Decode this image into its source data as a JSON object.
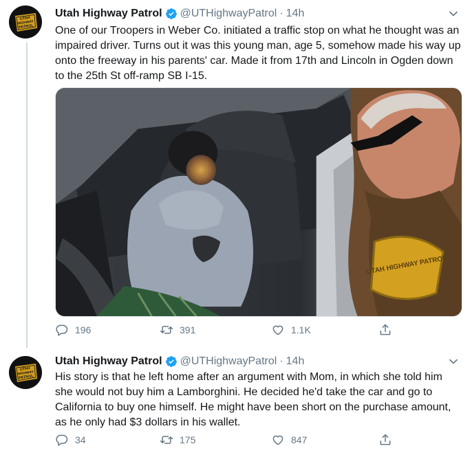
{
  "colors": {
    "text_primary": "#14171a",
    "text_secondary": "#657786",
    "verified_blue": "#1da1f2",
    "divider": "#cfd9de",
    "avatar_gold": "#d4a020"
  },
  "icons": {
    "verified": "verified-badge-icon",
    "caret": "chevron-down-icon",
    "reply": "reply-icon",
    "retweet": "retweet-icon",
    "like": "heart-icon",
    "share": "share-icon"
  },
  "tweets": [
    {
      "avatar_text": "UTAH HIGHWAY PATROL",
      "author_name": "Utah Highway Patrol",
      "handle": "@UTHighwayPatrol",
      "dot": "·",
      "time": "14h",
      "text": "One of our Troopers in Weber Co. initiated a traffic stop on what he thought was an impaired driver. Turns out it was this young man, age 5, somehow made his way up onto the freeway in his parents' car. Made it from 17th and Lincoln in Ogden down to the 25th St off-ramp SB I-15.",
      "media": {
        "patch_text": "UTAH HIGHWAY PATROL"
      },
      "replies": "196",
      "retweets": "391",
      "likes": "1.1K"
    },
    {
      "avatar_text": "UTAH HIGHWAY PATROL",
      "author_name": "Utah Highway Patrol",
      "handle": "@UTHighwayPatrol",
      "dot": "·",
      "time": "14h",
      "text": "His story is that he left home after an argument with Mom, in which she told him she would not buy him a Lamborghini. He decided he'd take the car and go to California to buy one himself. He might have been short on the purchase amount, as he only had $3 dollars in his wallet.",
      "replies": "34",
      "retweets": "175",
      "likes": "847"
    }
  ]
}
